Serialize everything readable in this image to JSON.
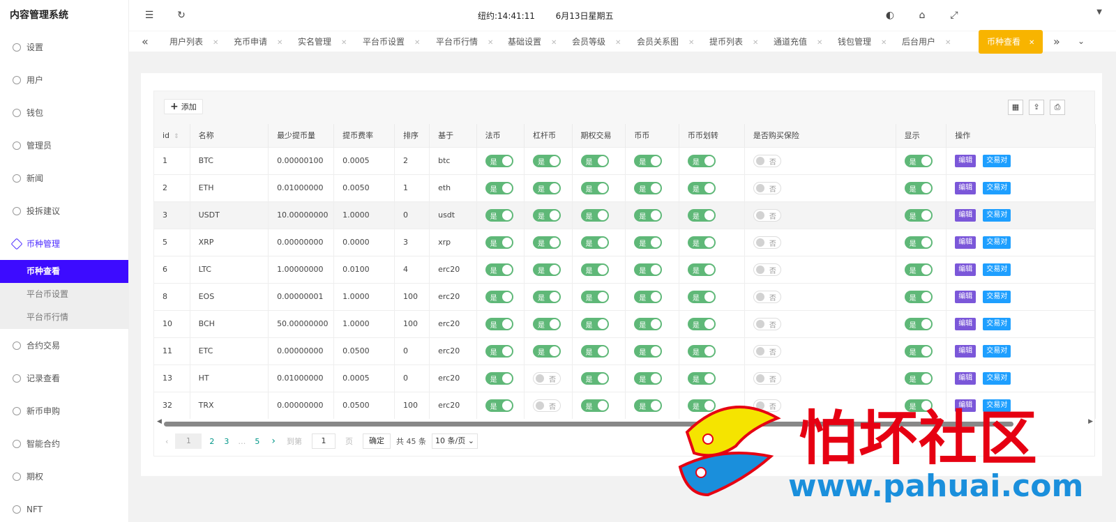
{
  "app_title": "内容管理系统",
  "sidebar": {
    "items_top": [
      {
        "label": "设置",
        "icon": "gear-icon"
      },
      {
        "label": "用户",
        "icon": "user-icon"
      },
      {
        "label": "钱包",
        "icon": "dollar-icon"
      },
      {
        "label": "管理员",
        "icon": "shield-icon"
      },
      {
        "label": "新闻",
        "icon": "tag-icon"
      },
      {
        "label": "投拆建议",
        "icon": "infinity-icon"
      },
      {
        "label": "币种管理",
        "icon": "diamond-icon"
      }
    ],
    "subitems": [
      {
        "label": "币种查看",
        "active": true
      },
      {
        "label": "平台币设置",
        "active": false
      },
      {
        "label": "平台币行情",
        "active": false
      }
    ],
    "items_bottom": [
      {
        "label": "合约交易",
        "icon": "diamond-icon"
      },
      {
        "label": "记录查看",
        "icon": "circle-icon"
      },
      {
        "label": "新币申购",
        "icon": "dollar-icon"
      },
      {
        "label": "智能合约",
        "icon": "circle-icon"
      },
      {
        "label": "期权",
        "icon": "circle-icon"
      },
      {
        "label": "NFT",
        "icon": "circle-icon"
      }
    ]
  },
  "topbar": {
    "clock_prefix": "纽约:14:41:11",
    "clock_suffix": "6月13日星期五"
  },
  "tabs": [
    "用户列表",
    "充币申请",
    "实名管理",
    "平台币设置",
    "平台币行情",
    "基础设置",
    "会员等级",
    "会员关系图",
    "提币列表",
    "通道充值",
    "钱包管理",
    "后台用户"
  ],
  "active_tab": "币种查看",
  "toolbar": {
    "add_label": "添加"
  },
  "table": {
    "headers": [
      "id",
      "名称",
      "最少提币量",
      "提币费率",
      "排序",
      "基于",
      "法币",
      "杠杆币",
      "期权交易",
      "币币",
      "币币划转",
      "是否购买保险",
      "显示",
      "操作"
    ],
    "on_label": "是",
    "off_label": "否",
    "edit_label": "编辑",
    "pair_label": "交易对",
    "rows": [
      {
        "id": "1",
        "name": "BTC",
        "min": "0.00000100",
        "fee": "0.0005",
        "sort": "2",
        "base": "btc",
        "fiat": true,
        "lev": true,
        "opt": true,
        "coin": true,
        "trans": true,
        "ins": false,
        "show": true
      },
      {
        "id": "2",
        "name": "ETH",
        "min": "0.01000000",
        "fee": "0.0050",
        "sort": "1",
        "base": "eth",
        "fiat": true,
        "lev": true,
        "opt": true,
        "coin": true,
        "trans": true,
        "ins": false,
        "show": true
      },
      {
        "id": "3",
        "name": "USDT",
        "min": "10.00000000",
        "fee": "1.0000",
        "sort": "0",
        "base": "usdt",
        "fiat": true,
        "lev": true,
        "opt": true,
        "coin": true,
        "trans": true,
        "ins": false,
        "show": true
      },
      {
        "id": "5",
        "name": "XRP",
        "min": "0.00000000",
        "fee": "0.0000",
        "sort": "3",
        "base": "xrp",
        "fiat": true,
        "lev": true,
        "opt": true,
        "coin": true,
        "trans": true,
        "ins": false,
        "show": true
      },
      {
        "id": "6",
        "name": "LTC",
        "min": "1.00000000",
        "fee": "0.0100",
        "sort": "4",
        "base": "erc20",
        "fiat": true,
        "lev": true,
        "opt": true,
        "coin": true,
        "trans": true,
        "ins": false,
        "show": true
      },
      {
        "id": "8",
        "name": "EOS",
        "min": "0.00000001",
        "fee": "1.0000",
        "sort": "100",
        "base": "erc20",
        "fiat": true,
        "lev": true,
        "opt": true,
        "coin": true,
        "trans": true,
        "ins": false,
        "show": true
      },
      {
        "id": "10",
        "name": "BCH",
        "min": "50.00000000",
        "fee": "1.0000",
        "sort": "100",
        "base": "erc20",
        "fiat": true,
        "lev": true,
        "opt": true,
        "coin": true,
        "trans": true,
        "ins": false,
        "show": true
      },
      {
        "id": "11",
        "name": "ETC",
        "min": "0.00000000",
        "fee": "0.0500",
        "sort": "0",
        "base": "erc20",
        "fiat": true,
        "lev": true,
        "opt": true,
        "coin": true,
        "trans": true,
        "ins": false,
        "show": true
      },
      {
        "id": "13",
        "name": "HT",
        "min": "0.01000000",
        "fee": "0.0005",
        "sort": "0",
        "base": "erc20",
        "fiat": true,
        "lev": false,
        "opt": true,
        "coin": true,
        "trans": true,
        "ins": false,
        "show": true
      },
      {
        "id": "32",
        "name": "TRX",
        "min": "0.00000000",
        "fee": "0.0500",
        "sort": "100",
        "base": "erc20",
        "fiat": true,
        "lev": false,
        "opt": true,
        "coin": true,
        "trans": true,
        "ins": false,
        "show": true
      }
    ]
  },
  "pager": {
    "current": "1",
    "pages": [
      "2",
      "3"
    ],
    "ellipsis": "…",
    "last": "5",
    "goto_label": "到第",
    "goto_value": "1",
    "page_unit": "页",
    "confirm": "确定",
    "total": "共 45 条",
    "per_page": "10 条/页"
  },
  "watermark": {
    "cn": "怕坏社区",
    "url": "www.pahuai.com"
  },
  "colors": {
    "accent": "#3d0bff",
    "switch_on": "#5fb878",
    "edit": "#7b57d9",
    "pair": "#1e9fff",
    "active_tab": "#f8b400"
  }
}
